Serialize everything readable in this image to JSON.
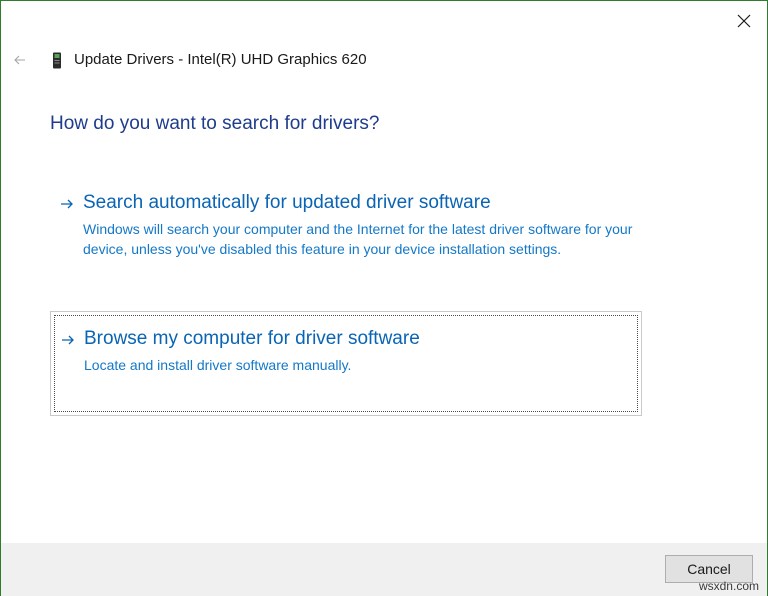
{
  "window": {
    "close_icon": "close-icon",
    "back_icon": "back-arrow-icon"
  },
  "header": {
    "title": "Update Drivers - Intel(R) UHD Graphics 620",
    "device_icon": "graphics-device-icon"
  },
  "main": {
    "question": "How do you want to search for drivers?",
    "options": [
      {
        "icon": "right-arrow-icon",
        "title": "Search automatically for updated driver software",
        "description": "Windows will search your computer and the Internet for the latest driver software for your device, unless you've disabled this feature in your device installation settings."
      },
      {
        "icon": "right-arrow-icon",
        "title": "Browse my computer for driver software",
        "description": "Locate and install driver software manually."
      }
    ]
  },
  "footer": {
    "cancel_label": "Cancel",
    "watermark": "wsxdn.com"
  },
  "colors": {
    "heading": "#1e3c8c",
    "link": "#0a64b4",
    "link_desc": "#1478c8",
    "footer_bg": "#f0f0f0"
  }
}
